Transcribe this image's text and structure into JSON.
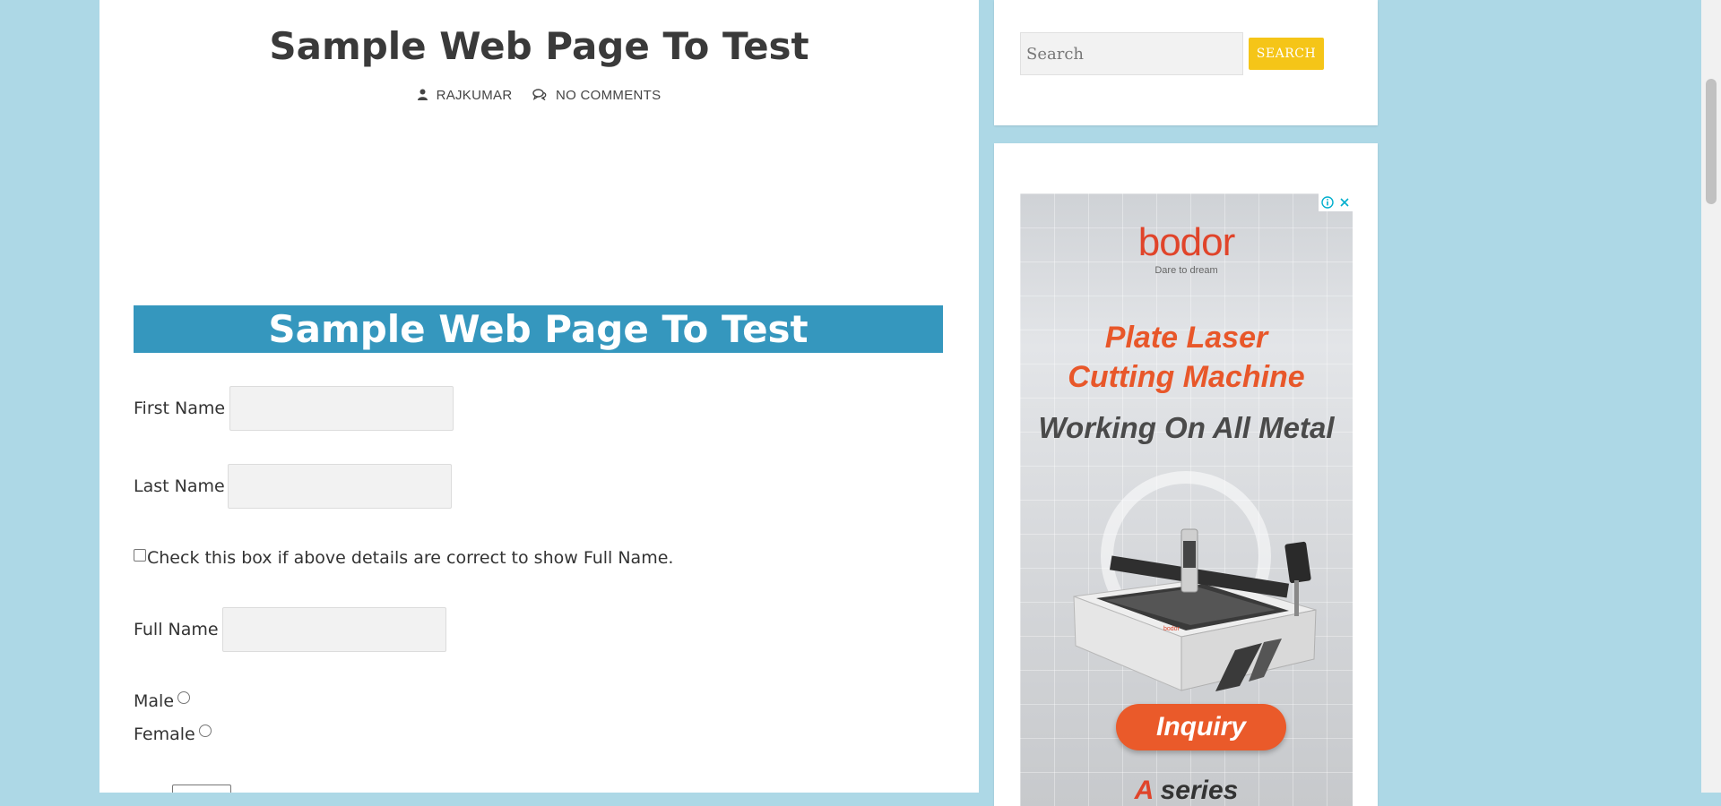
{
  "post": {
    "title": "Sample Web Page To Test",
    "author": "RAJKUMAR",
    "comments": "NO COMMENTS"
  },
  "form": {
    "banner_title": "Sample Web Page To Test",
    "first_name_label": "First Name",
    "first_name_value": "",
    "last_name_label": "Last Name",
    "last_name_value": "",
    "checkbox_label": "Check this box if above details are correct to show Full Name.",
    "full_name_label": "Full Name",
    "full_name_value": "",
    "gender_options": [
      "Male",
      "Female"
    ]
  },
  "sidebar": {
    "search_placeholder": "Search",
    "search_button": "SEARCH"
  },
  "ad": {
    "brand": "bodor",
    "tagline": "Dare to dream",
    "headline_1": "Plate Laser",
    "headline_2": "Cutting Machine",
    "subheadline": "Working On All Metal",
    "cta": "Inquiry",
    "footer_accent": "A",
    "footer_rest": " series"
  },
  "colors": {
    "page_background": "#add8e6",
    "banner": "#3597be",
    "search_button": "#f5c518",
    "ad_accent": "#e8572a"
  }
}
